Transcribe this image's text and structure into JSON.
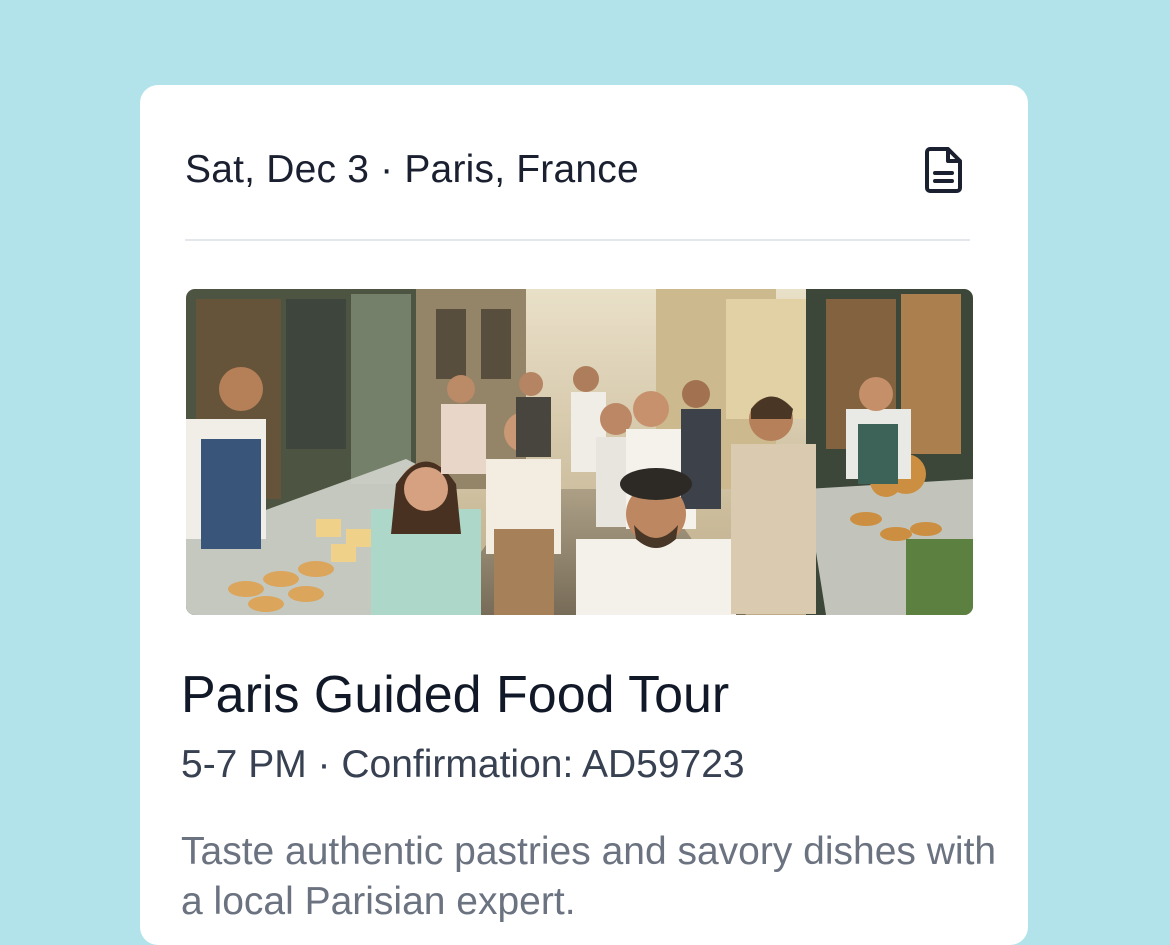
{
  "header": {
    "date": "Sat, Dec 3",
    "separator": "·",
    "location": "Paris, France",
    "date_location": "Sat, Dec 3 · Paris, France",
    "document_icon": "document-icon"
  },
  "hero_image": {
    "alt": "Bustling Paris street food market with people tasting pastries"
  },
  "tour": {
    "title": "Paris Guided Food Tour",
    "time_confirmation": "5-7 PM · Confirmation: AD59723",
    "description": "Taste authentic pastries and savory dishes with a local Parisian expert."
  },
  "colors": {
    "background": "#b3e3ea",
    "card": "#ffffff",
    "title": "#111827",
    "subtitle": "#374151",
    "description": "#6b7280",
    "divider": "#e3e6ea"
  }
}
